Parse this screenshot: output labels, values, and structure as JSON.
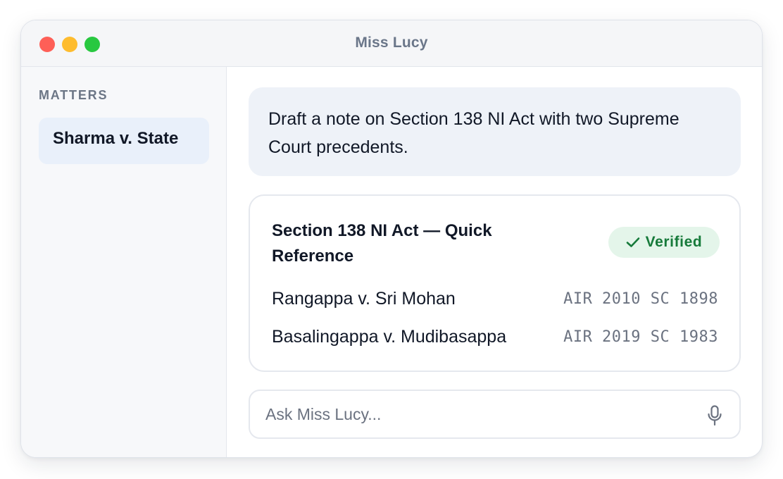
{
  "window": {
    "title": "Miss Lucy"
  },
  "sidebar": {
    "heading": "MATTERS",
    "items": [
      {
        "label": "Sharma v. State"
      }
    ]
  },
  "conversation": {
    "user_message": "Draft a note on Section 138 NI Act with two Supreme Court precedents.",
    "answer": {
      "title": "Section 138 NI Act — Quick Reference",
      "badge": "Verified",
      "cases": [
        {
          "name": "Rangappa v. Sri Mohan",
          "citation": "AIR 2010 SC 1898"
        },
        {
          "name": "Basalingappa v. Mudibasappa",
          "citation": "AIR 2019 SC 1983"
        }
      ]
    }
  },
  "composer": {
    "placeholder": "Ask Miss Lucy...",
    "value": ""
  },
  "icons": {
    "badge": "check-icon",
    "composer": "microphone-icon"
  },
  "colors": {
    "close": "#fe5f57",
    "minimize": "#febc2e",
    "zoom": "#28c840",
    "verified": "#167a3a",
    "verified_bg": "#e4f5ea",
    "selected_item_bg": "#e9f0fa"
  }
}
